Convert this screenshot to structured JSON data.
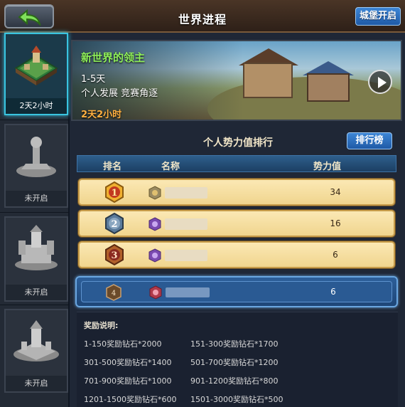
{
  "header": {
    "title": "世界进程",
    "castle_button": "城堡开启"
  },
  "sidebar": {
    "items": [
      {
        "label": "2天2小时",
        "active": true
      },
      {
        "label": "未开启",
        "active": false
      },
      {
        "label": "未开启",
        "active": false
      },
      {
        "label": "未开启",
        "active": false
      }
    ]
  },
  "banner": {
    "title": "新世界的领主",
    "days": "1-5天",
    "desc": "个人发展 竞赛角逐",
    "time": "2天2小时"
  },
  "ranking": {
    "title": "个人势力值排行",
    "list_button": "排行榜",
    "columns": [
      "排名",
      "名称",
      "势力值"
    ],
    "rows": [
      {
        "rank": "1",
        "value": "34"
      },
      {
        "rank": "2",
        "value": "16"
      },
      {
        "rank": "3",
        "value": "6"
      }
    ],
    "me": {
      "rank": "4",
      "value": "6"
    }
  },
  "reward": {
    "title": "奖励说明:",
    "items": [
      "1-150奖励钻石*2000",
      "151-300奖励钻石*1700",
      "301-500奖励钻石*1400",
      "501-700奖励钻石*1200",
      "701-900奖励钻石*1000",
      "901-1200奖励钻石*800",
      "1201-1500奖励钻石*600",
      "1501-3000奖励钻石*500"
    ]
  },
  "colors": {
    "accent_blue": "#1f5aa6",
    "active_cyan": "#39c4e0",
    "banner_title_green": "#8ff05a",
    "timer_orange": "#ffb040",
    "row_gold": "#f0d58e"
  }
}
